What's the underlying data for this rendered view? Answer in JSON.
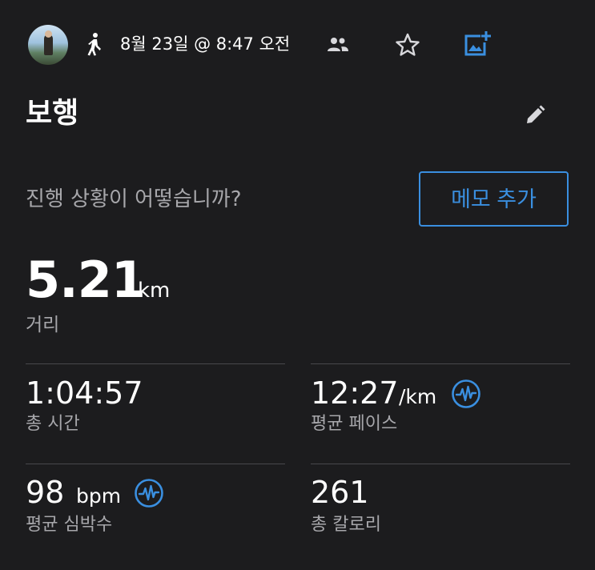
{
  "header": {
    "date_time": "8월 23일 @ 8:47 오전",
    "activity_icon": "walking-person-icon",
    "group_icon": "people-icon",
    "favorite_icon": "star-icon",
    "add_photo_icon": "add-photo-icon"
  },
  "activity": {
    "title": "보행",
    "edit_icon": "pencil-icon"
  },
  "notes": {
    "prompt": "진행 상황이 어떻습니까?",
    "add_memo_label": "메모 추가"
  },
  "distance": {
    "value": "5.21",
    "unit": "km",
    "label": "거리"
  },
  "stats": {
    "total_time": {
      "value": "1:04:57",
      "label": "총 시간"
    },
    "avg_pace": {
      "value": "12:27",
      "unit": "/km",
      "label": "평균 페이스"
    },
    "avg_hr": {
      "value": "98",
      "unit": "bpm",
      "label": "평균 심박수"
    },
    "calories": {
      "value": "261",
      "label": "총 칼로리"
    }
  },
  "colors": {
    "background": "#1c1c1e",
    "accent": "#3a8fe0",
    "secondary_text": "#a7a7ab",
    "divider": "#48484c"
  }
}
